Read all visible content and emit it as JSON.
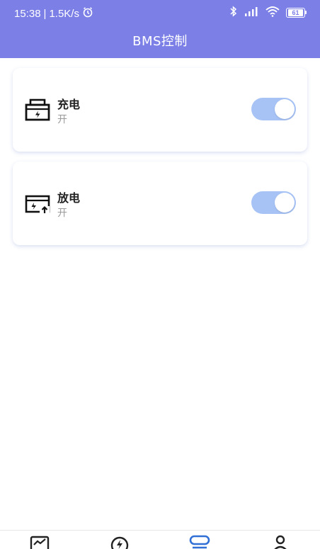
{
  "status_bar": {
    "time": "15:38",
    "separator": "|",
    "net_speed": "1.5K/s",
    "alarm_icon": "alarm-icon",
    "bluetooth_icon": "bluetooth-icon",
    "signal_icon": "cellular-signal-icon",
    "wifi_icon": "wifi-icon",
    "battery_level": "61"
  },
  "header": {
    "title": "BMS控制",
    "background_color": "#7b7fe6"
  },
  "controls": [
    {
      "icon": "charge-icon",
      "label": "充电",
      "state": "开",
      "enabled": true
    },
    {
      "icon": "discharge-icon",
      "label": "放电",
      "state": "开",
      "enabled": true
    }
  ],
  "toggle_on_color": "#a7c3f6",
  "bottom_nav": {
    "items": [
      {
        "icon": "chart-icon",
        "active": false
      },
      {
        "icon": "lightning-icon",
        "active": false
      },
      {
        "icon": "control-icon",
        "active": true
      },
      {
        "icon": "profile-icon",
        "active": false
      }
    ],
    "active_color": "#2f6fd6"
  }
}
